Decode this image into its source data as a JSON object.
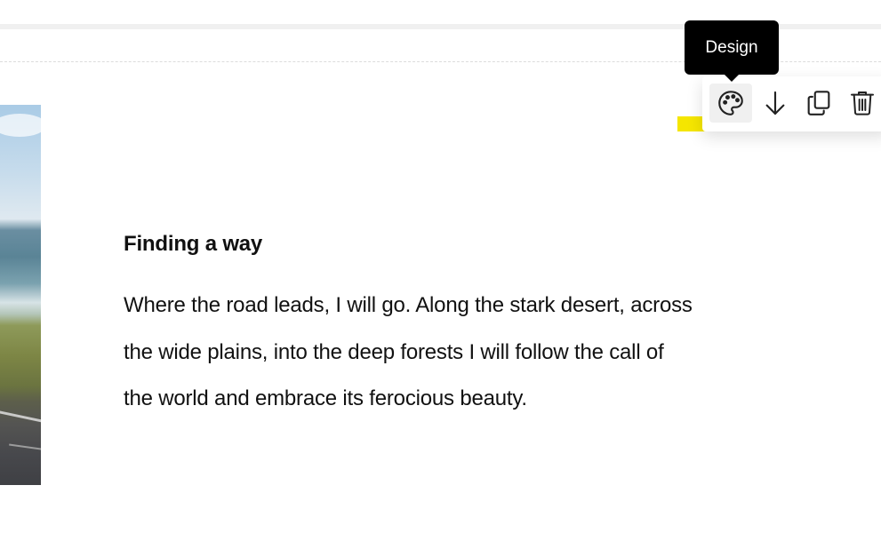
{
  "tooltip": {
    "label": "Design"
  },
  "toolbar": {
    "buttons": [
      {
        "name": "design",
        "icon": "palette-icon"
      },
      {
        "name": "move-down",
        "icon": "arrow-down-icon"
      },
      {
        "name": "duplicate",
        "icon": "copy-icon"
      },
      {
        "name": "delete",
        "icon": "trash-icon"
      }
    ],
    "highlight_color": "#f5e600"
  },
  "content": {
    "heading": "Finding a way",
    "paragraph": "Where the road leads, I will go. Along the stark desert, across the wide plains, into the deep forests I will follow the call of the world and embrace its ferocious beauty."
  }
}
